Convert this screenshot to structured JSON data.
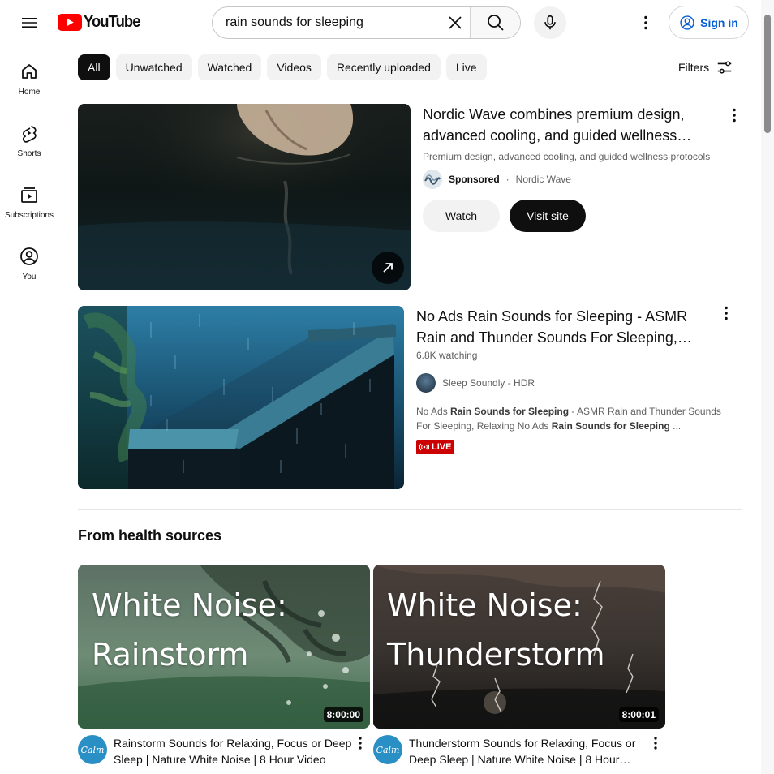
{
  "header": {
    "logo_text": "YouTube",
    "search_value": "rain sounds for sleeping",
    "search_placeholder": "Search",
    "signin_label": "Sign in"
  },
  "guide": {
    "items": [
      {
        "label": "Home",
        "icon": "home-icon"
      },
      {
        "label": "Shorts",
        "icon": "shorts-icon"
      },
      {
        "label": "Subscriptions",
        "icon": "subscriptions-icon"
      },
      {
        "label": "You",
        "icon": "you-icon"
      }
    ]
  },
  "chips": {
    "items": [
      "All",
      "Unwatched",
      "Watched",
      "Videos",
      "Recently uploaded",
      "Live"
    ],
    "active": "All",
    "filters_label": "Filters"
  },
  "ad": {
    "title": "Nordic Wave combines premium design, advanced cooling, and guided wellness…",
    "description": "Premium design, advanced cooling, and guided wellness protocols",
    "sponsored_label": "Sponsored",
    "separator": "·",
    "advertiser": "Nordic Wave",
    "watch_label": "Watch",
    "visit_label": "Visit site"
  },
  "video": {
    "title": "No Ads Rain Sounds for Sleeping - ASMR Rain and Thunder Sounds For Sleeping,…",
    "views": "6.8K watching",
    "channel": "Sleep Soundly - HDR",
    "snippet_parts": [
      {
        "text": "No Ads ",
        "bold": false
      },
      {
        "text": "Rain Sounds for Sleeping",
        "bold": true
      },
      {
        "text": " - ASMR Rain and Thunder Sounds For Sleeping, Relaxing No Ads ",
        "bold": false
      },
      {
        "text": "Rain Sounds for Sleeping",
        "bold": true
      },
      {
        "text": " ...",
        "bold": false
      }
    ],
    "live_label": "LIVE"
  },
  "shelf": {
    "title": "From health sources",
    "cards": [
      {
        "overlay_line1": "White Noise:",
        "overlay_line2": "Rainstorm",
        "duration": "8:00:00",
        "avatar_text": "Calm",
        "title": "Rainstorm Sounds for Relaxing, Focus or Deep Sleep | Nature White Noise | 8 Hour Video"
      },
      {
        "overlay_line1": "White Noise:",
        "overlay_line2": "Thunderstorm",
        "duration": "8:00:01",
        "avatar_text": "Calm",
        "title": "Thunderstorm Sounds for Relaxing, Focus or Deep Sleep | Nature White Noise | 8 Hour…"
      }
    ]
  },
  "colors": {
    "brand_red": "#ff0000",
    "link_blue": "#065fd4",
    "live_red": "#cc0000",
    "calm_blue": "#2a8fc4"
  }
}
